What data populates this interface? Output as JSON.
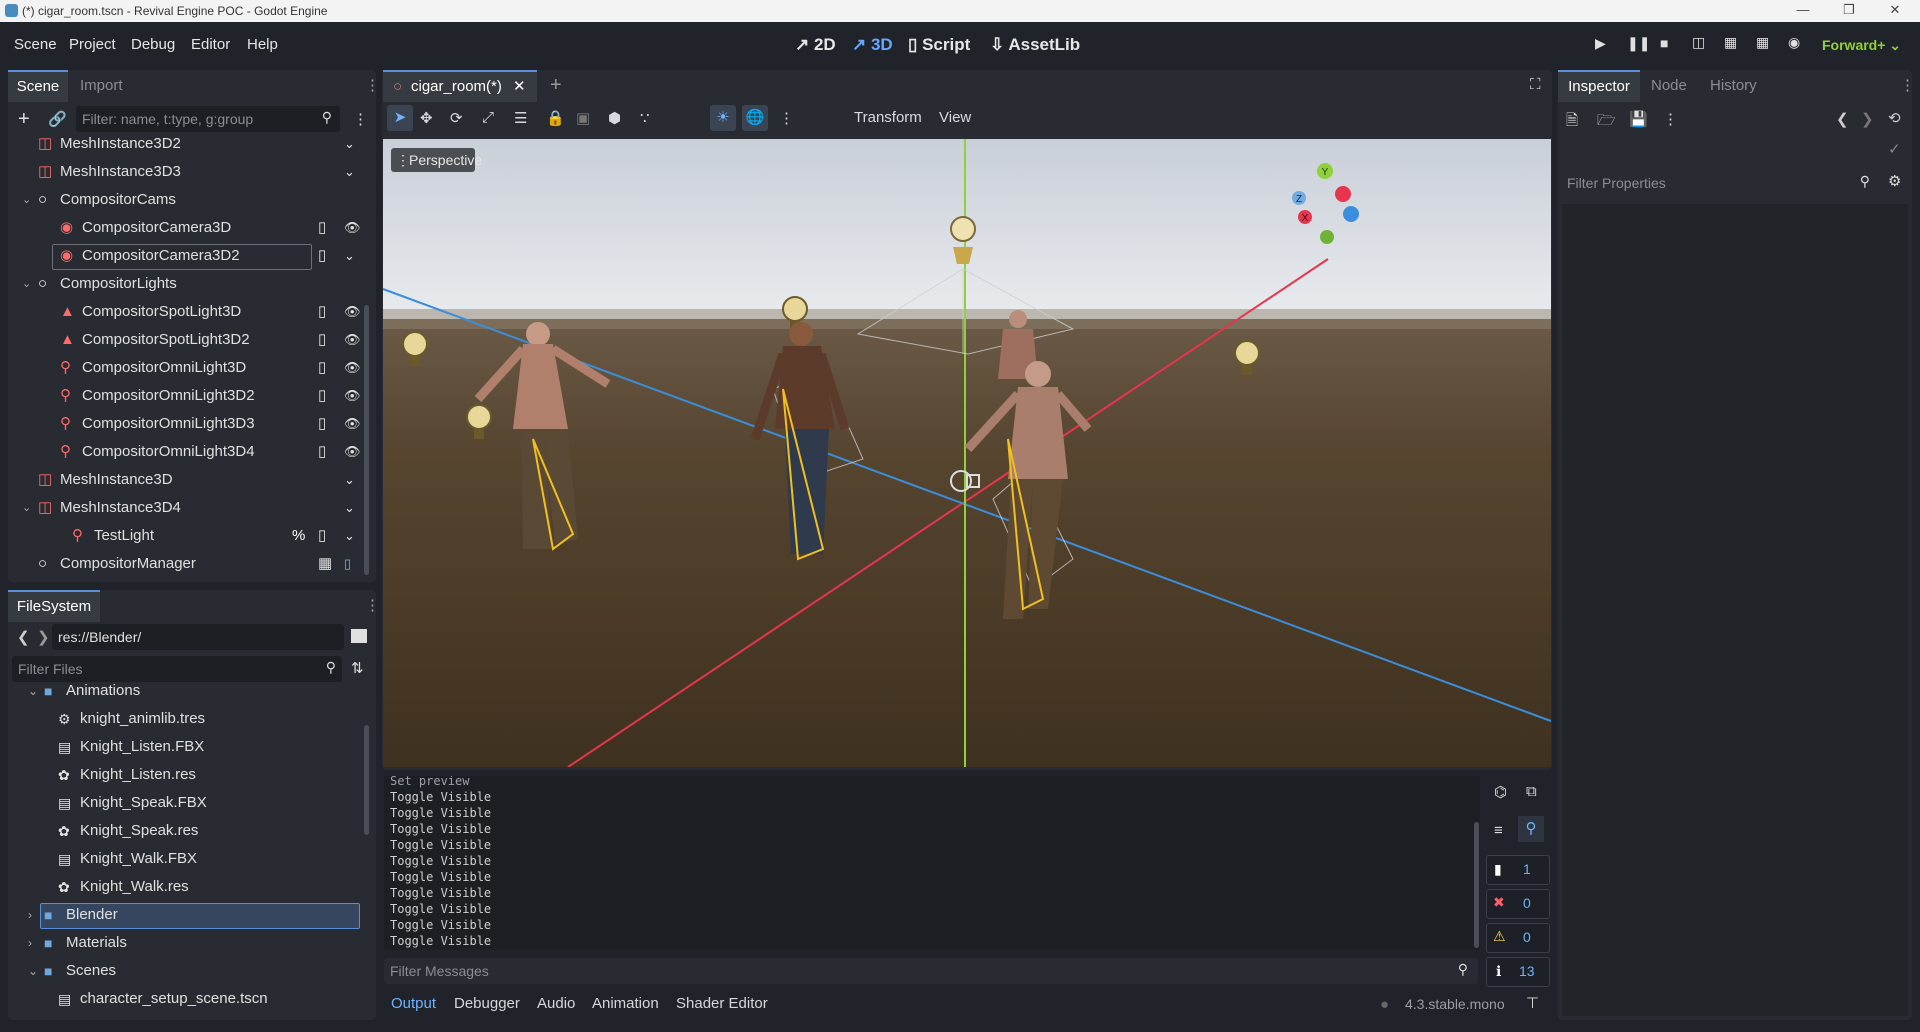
{
  "window": {
    "title": "(*) cigar_room.tscn - Revival Engine POC - Godot Engine"
  },
  "menus": [
    "Scene",
    "Project",
    "Debug",
    "Editor",
    "Help"
  ],
  "modes": {
    "m2d": "2D",
    "m3d": "3D",
    "script": "Script",
    "assetlib": "AssetLib"
  },
  "renderer": "Forward+",
  "scene_dock": {
    "tabs": [
      "Scene",
      "Import"
    ],
    "filter_placeholder": "Filter: name, t:type, g:group",
    "nodes": [
      {
        "label": "MeshInstance3D2",
        "icon": "mesh-icon"
      },
      {
        "label": "MeshInstance3D3",
        "icon": "mesh-icon"
      },
      {
        "label": "CompositorCams",
        "icon": "node3d-icon"
      },
      {
        "label": "CompositorCamera3D",
        "icon": "camera-icon"
      },
      {
        "label": "CompositorCamera3D2",
        "icon": "camera-icon"
      },
      {
        "label": "CompositorLights",
        "icon": "node3d-icon"
      },
      {
        "label": "CompositorSpotLight3D",
        "icon": "spotlight-icon"
      },
      {
        "label": "CompositorSpotLight3D2",
        "icon": "spotlight-icon"
      },
      {
        "label": "CompositorOmniLight3D",
        "icon": "omnilight-icon"
      },
      {
        "label": "CompositorOmniLight3D2",
        "icon": "omnilight-icon"
      },
      {
        "label": "CompositorOmniLight3D3",
        "icon": "omnilight-icon"
      },
      {
        "label": "CompositorOmniLight3D4",
        "icon": "omnilight-icon"
      },
      {
        "label": "MeshInstance3D",
        "icon": "mesh-icon"
      },
      {
        "label": "MeshInstance3D4",
        "icon": "mesh-icon"
      },
      {
        "label": "TestLight",
        "icon": "omnilight-icon",
        "extra": "%"
      },
      {
        "label": "CompositorManager",
        "icon": "node3d-icon"
      }
    ]
  },
  "filesystem": {
    "tab": "FileSystem",
    "path": "res://Blender/",
    "filter_placeholder": "Filter Files",
    "items": [
      {
        "label": "Animations",
        "icon": "folder-icon"
      },
      {
        "label": "knight_animlib.tres",
        "icon": "animlib-icon"
      },
      {
        "label": "Knight_Listen.FBX",
        "icon": "scene-file-icon"
      },
      {
        "label": "Knight_Listen.res",
        "icon": "resource-icon"
      },
      {
        "label": "Knight_Speak.FBX",
        "icon": "scene-file-icon"
      },
      {
        "label": "Knight_Speak.res",
        "icon": "resource-icon"
      },
      {
        "label": "Knight_Walk.FBX",
        "icon": "scene-file-icon"
      },
      {
        "label": "Knight_Walk.res",
        "icon": "resource-icon"
      },
      {
        "label": "Blender",
        "icon": "folder-icon"
      },
      {
        "label": "Materials",
        "icon": "folder-icon"
      },
      {
        "label": "Scenes",
        "icon": "folder-icon"
      },
      {
        "label": "character_setup_scene.tscn",
        "icon": "scene-file-icon"
      }
    ]
  },
  "editor": {
    "tab": "cigar_room(*)",
    "toolbar_menus": [
      "Transform",
      "View"
    ],
    "viewport_label": "Perspective",
    "gizmo_axes": {
      "x": "X",
      "y": "Y",
      "z": "Z"
    },
    "colors": {
      "x_axis": "#e8354f",
      "y_axis": "#8fd13a",
      "z_axis": "#3b8edb",
      "accent": "#5a8fd8"
    }
  },
  "output": {
    "lines": [
      "Set preview",
      "Toggle Visible",
      "Toggle Visible",
      "Toggle Visible",
      "Toggle Visible",
      "Toggle Visible",
      "Toggle Visible",
      "Toggle Visible",
      "Toggle Visible",
      "Toggle Visible",
      "Toggle Visible"
    ],
    "filter_placeholder": "Filter Messages",
    "counts": {
      "messages": "1",
      "errors": "0",
      "warnings": "0",
      "info": "13"
    },
    "bottom_tabs": [
      "Output",
      "Debugger",
      "Audio",
      "Animation",
      "Shader Editor"
    ],
    "version": "4.3.stable.mono"
  },
  "inspector": {
    "tabs": [
      "Inspector",
      "Node",
      "History"
    ],
    "filter_placeholder": "Filter Properties"
  }
}
